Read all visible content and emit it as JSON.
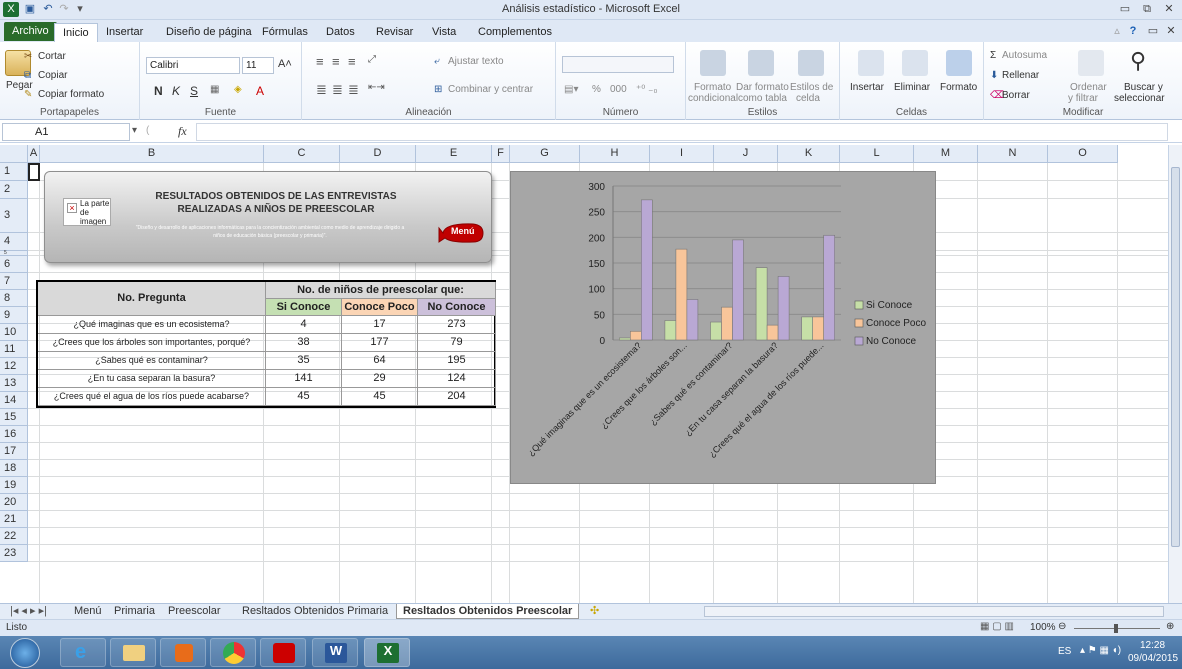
{
  "window": {
    "title": "Análisis estadístico - Microsoft Excel"
  },
  "tabs": [
    "Archivo",
    "Inicio",
    "Insertar",
    "Diseño de página",
    "Fórmulas",
    "Datos",
    "Revisar",
    "Vista",
    "Complementos"
  ],
  "ribbon": {
    "clipboard": {
      "paste": "Pegar",
      "cut": "Cortar",
      "copy": "Copiar",
      "copy_format": "Copiar formato",
      "label": "Portapapeles"
    },
    "font": {
      "name": "Calibri",
      "size": "11",
      "bold": "N",
      "italic": "K",
      "underline": "S",
      "label": "Fuente"
    },
    "alignment": {
      "wrap": "Ajustar texto",
      "merge": "Combinar y centrar",
      "label": "Alineación"
    },
    "number": {
      "percent": "%",
      "thousands": "000",
      "label": "Número"
    },
    "styles": {
      "conditional_l1": "Formato",
      "conditional_l2": "condicional",
      "table_l1": "Dar formato",
      "table_l2": "como tabla",
      "cell_l1": "Estilos de",
      "cell_l2": "celda",
      "label": "Estilos"
    },
    "cells": {
      "insert": "Insertar",
      "delete": "Eliminar",
      "format": "Formato",
      "label": "Celdas"
    },
    "editing": {
      "autosum": "Autosuma",
      "fill": "Rellenar",
      "clear": "Borrar",
      "sort_l1": "Ordenar",
      "sort_l2": "y filtrar",
      "find_l1": "Buscar y",
      "find_l2": "seleccionar",
      "label": "Modificar"
    }
  },
  "formula_bar": {
    "cell_ref": "A1",
    "fx": "fx"
  },
  "columns": [
    "A",
    "B",
    "C",
    "D",
    "E",
    "F",
    "G",
    "H",
    "I",
    "J",
    "K",
    "L",
    "M",
    "N",
    "O"
  ],
  "rows": [
    "1",
    "2",
    "3",
    "4",
    "5",
    "6",
    "7",
    "8",
    "9",
    "10",
    "11",
    "12",
    "13",
    "14",
    "15",
    "16",
    "17",
    "18",
    "19",
    "20",
    "21",
    "22",
    "23"
  ],
  "card": {
    "title": "RESULTADOS  OBTENIDOS  DE LAS ENTREVISTAS REALIZADAS  A NIÑOS DE PREESCOLAR",
    "subtitle": "\"Diseño y desarrollo de aplicaciones  informáticas para la concientización  ambiental como medio de aprendizaje dirigido a niños de educación  básica (preescolar y primaria)\".",
    "image_alt": "La parte de imagen",
    "menu": "Menú"
  },
  "table": {
    "header_question": "No. Pregunta",
    "header_group": "No. de niños de preescolar que:",
    "col_headers": [
      "Si Conoce",
      "Conoce Poco",
      "No Conoce"
    ],
    "rows": [
      {
        "q": "¿Qué imaginas que es un ecosistema?",
        "v": [
          "4",
          "17",
          "273"
        ]
      },
      {
        "q": "¿Crees que los árboles son importantes, porqué?",
        "v": [
          "38",
          "177",
          "79"
        ]
      },
      {
        "q": "¿Sabes qué es contaminar?",
        "v": [
          "35",
          "64",
          "195"
        ]
      },
      {
        "q": "¿En tu casa separan la basura?",
        "v": [
          "141",
          "29",
          "124"
        ]
      },
      {
        "q": "¿Crees qué el agua de los ríos puede acabarse?",
        "v": [
          "45",
          "45",
          "204"
        ]
      }
    ]
  },
  "chart_data": {
    "type": "bar",
    "categories": [
      "¿Qué imaginas que es un ecosistema?",
      "¿Crees que los árboles son...",
      "¿Sabes qué es contaminar?",
      "¿En tu casa separan la basura?",
      "¿Crees qué el agua de los ríos puede..."
    ],
    "series": [
      {
        "name": "Si Conoce",
        "values": [
          4,
          38,
          35,
          141,
          45
        ],
        "color": "#c6dfa7"
      },
      {
        "name": "Conoce Poco",
        "values": [
          17,
          177,
          64,
          29,
          45
        ],
        "color": "#f8c59a"
      },
      {
        "name": "No Conoce",
        "values": [
          273,
          79,
          195,
          124,
          204
        ],
        "color": "#b9a8d4"
      }
    ],
    "ylim": [
      0,
      300
    ],
    "yticks": [
      0,
      50,
      100,
      150,
      200,
      250,
      300
    ],
    "grid": true,
    "legend": "right"
  },
  "sheet_tabs": [
    "Menú",
    "Primaria",
    "Preescolar",
    "Resltados Obtenidos Primaria",
    "Resltados Obtenidos Preescolar"
  ],
  "active_sheet": "Resltados Obtenidos Preescolar",
  "status": {
    "mode": "Listo",
    "zoom": "100%"
  },
  "taskbar": {
    "lang": "ES",
    "time": "12:28",
    "date": "09/04/2015"
  }
}
